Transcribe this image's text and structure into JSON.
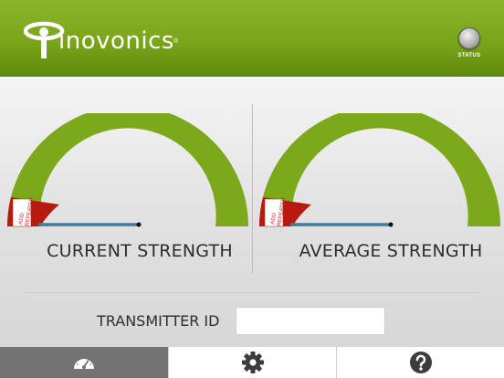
{
  "header": {
    "brand": "inovonics",
    "brand_mark": "®",
    "status_label": "STATUS"
  },
  "gauges": {
    "left": {
      "title": "CURRENT STRENGTH",
      "warning_label_line1": "ADD",
      "warning_label_line2": "REPEATER"
    },
    "right": {
      "title": "AVERAGE STRENGTH",
      "warning_label_line1": "ADD",
      "warning_label_line2": "REPEATER"
    }
  },
  "transmitter": {
    "label": "TRANSMITTER ID",
    "value": "",
    "placeholder": ""
  },
  "tabs": [
    {
      "icon": "speedometer-icon",
      "active": true
    },
    {
      "icon": "gear-icon",
      "active": false
    },
    {
      "icon": "help-icon",
      "active": false
    }
  ],
  "colors": {
    "header_green": "#7aa51a",
    "gauge_green": "#7ca81c",
    "gauge_red": "#b81a10",
    "needle_blue": "#3d7ba0",
    "active_tab": "#737373"
  }
}
